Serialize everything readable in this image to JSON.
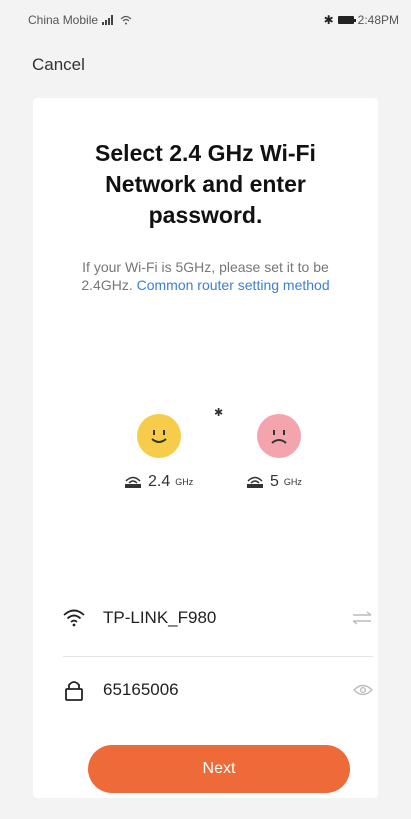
{
  "status_bar": {
    "carrier": "China Mobile",
    "time": "2:48PM"
  },
  "header": {
    "cancel_label": "Cancel"
  },
  "card": {
    "title": "Select 2.4 GHz Wi-Fi Network and enter password.",
    "hint_text": "If your Wi-Fi is 5GHz, please set it to be 2.4GHz.",
    "hint_link": "Common router setting method",
    "bands": [
      {
        "value": "2.4",
        "unit": "GHz"
      },
      {
        "value": "5",
        "unit": "GHz"
      }
    ],
    "wifi_name": "TP-LINK_F980",
    "password": "65165006",
    "next_label": "Next"
  },
  "colors": {
    "accent": "#ee6a38",
    "link": "#3a7fd5",
    "good_face": "#f7cc4a",
    "bad_face": "#f4a4ac"
  }
}
